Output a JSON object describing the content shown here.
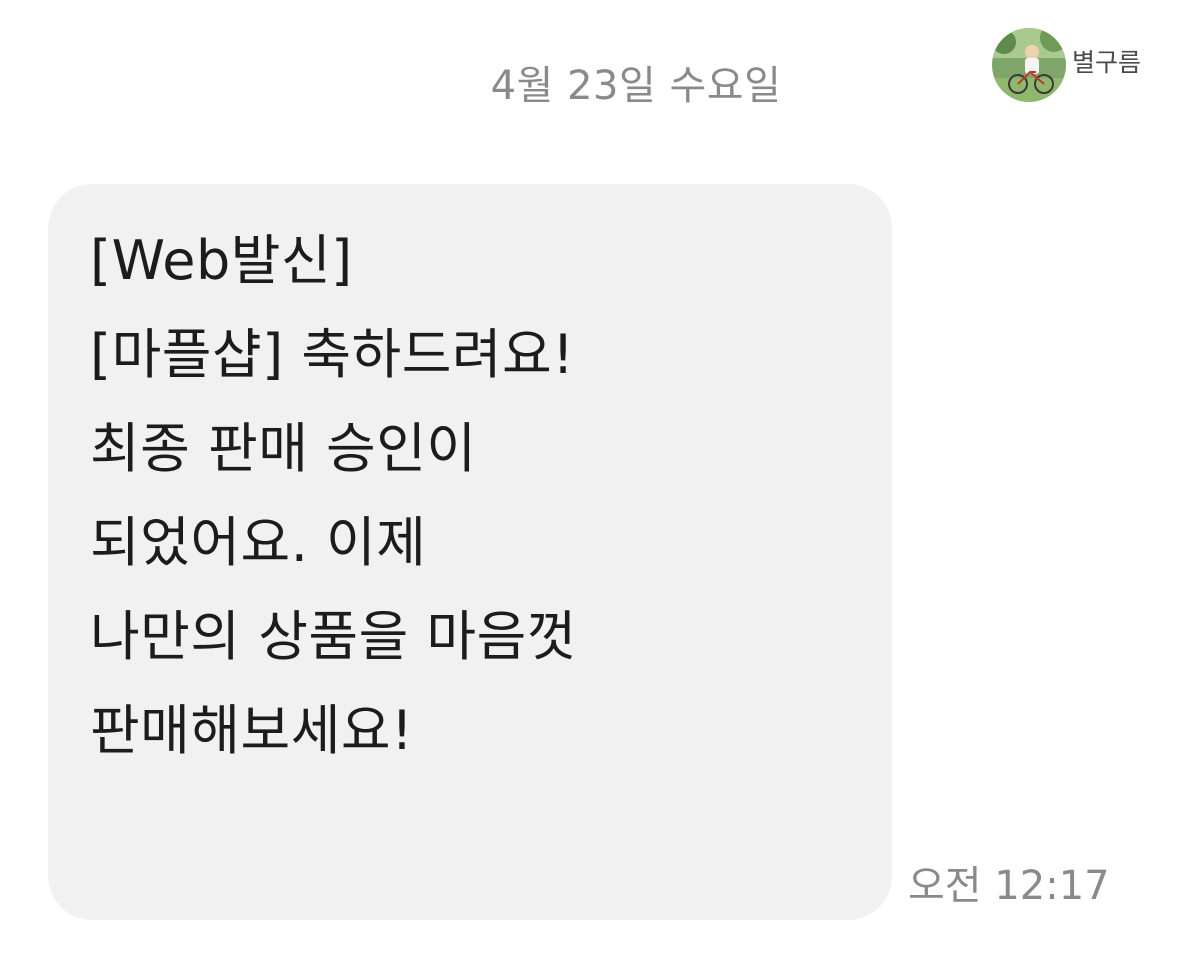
{
  "date_header": "4월 23일 수요일",
  "sender": {
    "name": "별구름",
    "avatar": "avatar-photo-cyclist"
  },
  "message": {
    "lines": [
      "[Web발신]",
      "[마플샵] 축하드려요!",
      "최종 판매 승인이",
      "되었어요. 이제",
      "나만의 상품을 마음껏",
      "판매해보세요!"
    ],
    "time": "오전 12:17"
  },
  "colors": {
    "background": "#ffffff",
    "bubble": "#f1f1f1",
    "text": "#1c1c1c",
    "muted": "#8a8a8a"
  }
}
